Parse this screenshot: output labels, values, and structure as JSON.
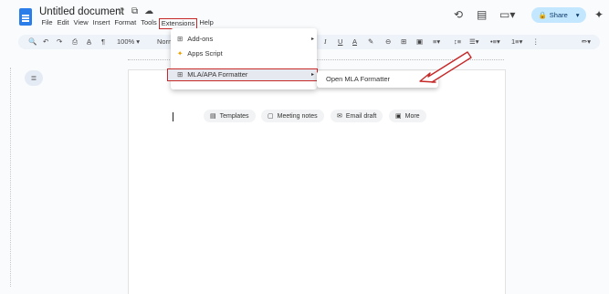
{
  "document": {
    "title": "Untitled document",
    "title_icons": [
      "☆",
      "⧉",
      "☁"
    ]
  },
  "menubar": {
    "items": [
      "File",
      "Edit",
      "View",
      "Insert",
      "Format",
      "Tools",
      "Extensions",
      "Help"
    ],
    "highlighted": "Extensions"
  },
  "header": {
    "history_icon": "history-icon",
    "comment_icon": "comment-icon",
    "meet_icon": "video-call-icon",
    "share_label": "Share",
    "ai_icon": "sparkle-icon",
    "highlight_color": "#c62828",
    "share_bg": "#c2e7ff"
  },
  "toolbar": {
    "search": "🔍",
    "undo": "↶",
    "redo": "↷",
    "print": "⎙",
    "spellcheck": "A̲",
    "paint_format": "¶",
    "zoom": "100%",
    "style_partial": "Norm",
    "italic": "I",
    "underline": "U",
    "text_color": "A",
    "highlight": "✎",
    "link": "⊖",
    "comment": "⊞",
    "image": "▣",
    "align": "≡",
    "line_spacing": "↕≡",
    "checklist": "☰",
    "bullets": "•≡",
    "numbered": "1≡",
    "more": "⋮",
    "edit_mode": "✏"
  },
  "extensions_menu": {
    "items": [
      {
        "icon": "add-ons-icon",
        "glyph": "⊞",
        "label": "Add-ons",
        "arrow": "▸"
      },
      {
        "icon": "apps-script-icon",
        "glyph": "✦",
        "label": "Apps Script",
        "arrow": ""
      },
      {
        "icon": "formatter-icon",
        "glyph": "⊞",
        "label": "MLA/APA Formatter",
        "arrow": "▸"
      }
    ]
  },
  "submenu": {
    "item": "Open MLA Formatter"
  },
  "outline_icon": "≣",
  "chips": [
    {
      "icon": "template-icon",
      "glyph": "▤",
      "label": "Templates"
    },
    {
      "icon": "meeting-notes-icon",
      "glyph": "▢",
      "label": "Meeting notes"
    },
    {
      "icon": "email-draft-icon",
      "glyph": "✉",
      "label": "Email draft"
    },
    {
      "icon": "more-icon",
      "glyph": "▣",
      "label": "More"
    }
  ]
}
